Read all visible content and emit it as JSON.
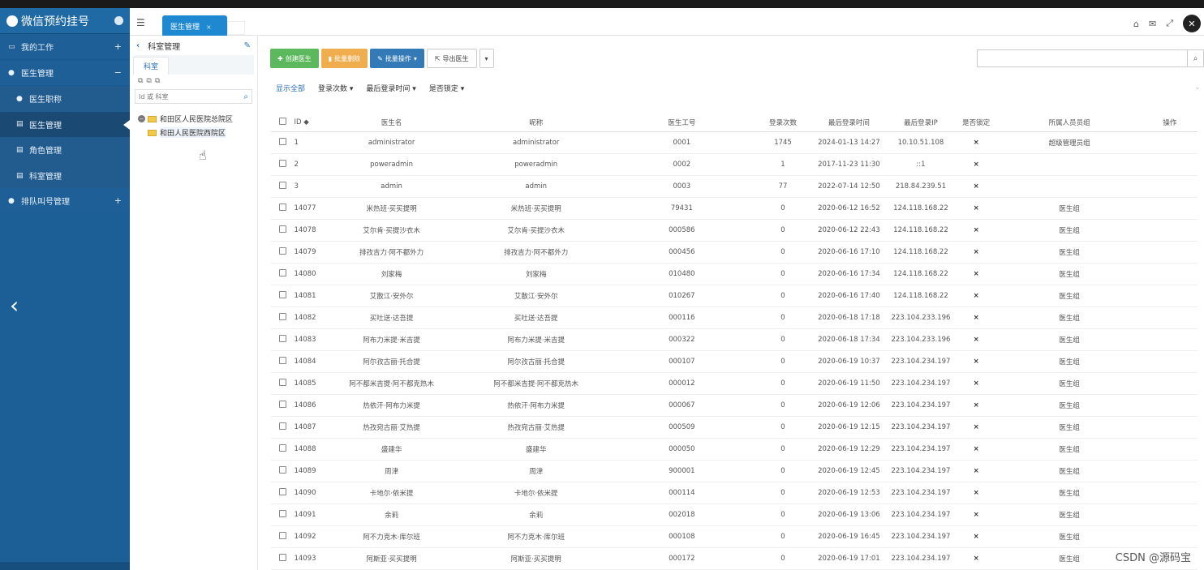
{
  "app": {
    "title": "微信预约挂号"
  },
  "sidebar": {
    "items": [
      {
        "label": "我的工作",
        "icon": "laptop-icon",
        "toggle": "+"
      },
      {
        "label": "医生管理",
        "icon": "user-icon",
        "toggle": "−"
      },
      {
        "label": "医生职称",
        "icon": "user-icon"
      },
      {
        "label": "医生管理",
        "icon": "file-icon"
      },
      {
        "label": "角色管理",
        "icon": "file-icon"
      },
      {
        "label": "科室管理",
        "icon": "file-icon"
      },
      {
        "label": "排队叫号管理",
        "icon": "user-icon",
        "toggle": "+"
      }
    ]
  },
  "tabs": [
    {
      "label": "医生管理",
      "close": "×"
    }
  ],
  "tree_panel": {
    "title": "科室管理",
    "tab": "科室",
    "tools": "⧉⧉⧉",
    "search_placeholder": "Id 或 科室",
    "nodes": [
      {
        "label": "和田区人民医院总院区"
      },
      {
        "label": "和田人民医院西院区"
      }
    ]
  },
  "toolbar": {
    "create": "创建医生",
    "batch_delete": "批量删除",
    "batch_ops": "批量操作",
    "export": "导出医生"
  },
  "filters": [
    "显示全部",
    "登录次数",
    "最后登录时间",
    "是否锁定"
  ],
  "table": {
    "headers": [
      "ID",
      "医生名",
      "昵称",
      "医生工号",
      "登录次数",
      "最后登录时间",
      "最后登录IP",
      "是否锁定",
      "所属人员员组",
      "操作"
    ],
    "rows": [
      [
        "1",
        "administrator",
        "administrator",
        "0001",
        "1745",
        "2024-01-13 14:27",
        "10.10.51.108",
        "×",
        "超级管理员组"
      ],
      [
        "2",
        "poweradmin",
        "poweradmin",
        "0002",
        "1",
        "2017-11-23 11:30",
        "::1",
        "×",
        ""
      ],
      [
        "3",
        "admin",
        "admin",
        "0003",
        "77",
        "2022-07-14 12:50",
        "218.84.239.51",
        "×",
        ""
      ],
      [
        "14077",
        "米热班·买买提明",
        "米热班·买买提明",
        "79431",
        "0",
        "2020-06-12 16:52",
        "124.118.168.22",
        "×",
        "医生组"
      ],
      [
        "14078",
        "艾尔肯·买提沙衣木",
        "艾尔肯·买提沙衣木",
        "000586",
        "0",
        "2020-06-12 22:43",
        "124.118.168.22",
        "×",
        "医生组"
      ],
      [
        "14079",
        "排孜吉力·阿不都外力",
        "排孜吉力·阿不都外力",
        "000456",
        "0",
        "2020-06-16 17:10",
        "124.118.168.22",
        "×",
        "医生组"
      ],
      [
        "14080",
        "刘家梅",
        "刘家梅",
        "010480",
        "0",
        "2020-06-16 17:34",
        "124.118.168.22",
        "×",
        "医生组"
      ],
      [
        "14081",
        "艾散江·安外尔",
        "艾散江·安外尔",
        "010267",
        "0",
        "2020-06-16 17:40",
        "124.118.168.22",
        "×",
        "医生组"
      ],
      [
        "14082",
        "买吐送·达吾提",
        "买吐送·达吾提",
        "000116",
        "0",
        "2020-06-18 17:18",
        "223.104.233.196",
        "×",
        "医生组"
      ],
      [
        "14083",
        "阿布力米提·米吉提",
        "阿布力米提·米吉提",
        "000322",
        "0",
        "2020-06-18 17:34",
        "223.104.233.196",
        "×",
        "医生组"
      ],
      [
        "14084",
        "阿尔孜古丽·托合提",
        "阿尔孜古丽·托合提",
        "000107",
        "0",
        "2020-06-19 10:37",
        "223.104.234.197",
        "×",
        "医生组"
      ],
      [
        "14085",
        "阿不都米吉提·阿不都克热木",
        "阿不都米吉提·阿不都克热木",
        "000012",
        "0",
        "2020-06-19 11:50",
        "223.104.234.197",
        "×",
        "医生组"
      ],
      [
        "14086",
        "热依汗·阿布力米提",
        "热依汗·阿布力米提",
        "000067",
        "0",
        "2020-06-19 12:06",
        "223.104.234.197",
        "×",
        "医生组"
      ],
      [
        "14087",
        "热孜宛古丽·艾热提",
        "热孜宛古丽·艾热提",
        "000509",
        "0",
        "2020-06-19 12:15",
        "223.104.234.197",
        "×",
        "医生组"
      ],
      [
        "14088",
        "盛建华",
        "盛建华",
        "000050",
        "0",
        "2020-06-19 12:29",
        "223.104.234.197",
        "×",
        "医生组"
      ],
      [
        "14089",
        "周津",
        "周津",
        "900001",
        "0",
        "2020-06-19 12:45",
        "223.104.234.197",
        "×",
        "医生组"
      ],
      [
        "14090",
        "卡地尔·依米提",
        "卡地尔·依米提",
        "000114",
        "0",
        "2020-06-19 12:53",
        "223.104.234.197",
        "×",
        "医生组"
      ],
      [
        "14091",
        "余莉",
        "余莉",
        "002018",
        "0",
        "2020-06-19 13:06",
        "223.104.234.197",
        "×",
        "医生组"
      ],
      [
        "14092",
        "阿不力克木·库尔班",
        "阿不力克木·库尔班",
        "000108",
        "0",
        "2020-06-19 16:45",
        "223.104.234.197",
        "×",
        "医生组"
      ],
      [
        "14093",
        "阿斯亚·买买提明",
        "阿斯亚·买买提明",
        "000172",
        "0",
        "2020-06-19 17:01",
        "223.104.234.197",
        "×",
        "医生组"
      ]
    ]
  },
  "watermark": "CSDN @源码宝"
}
